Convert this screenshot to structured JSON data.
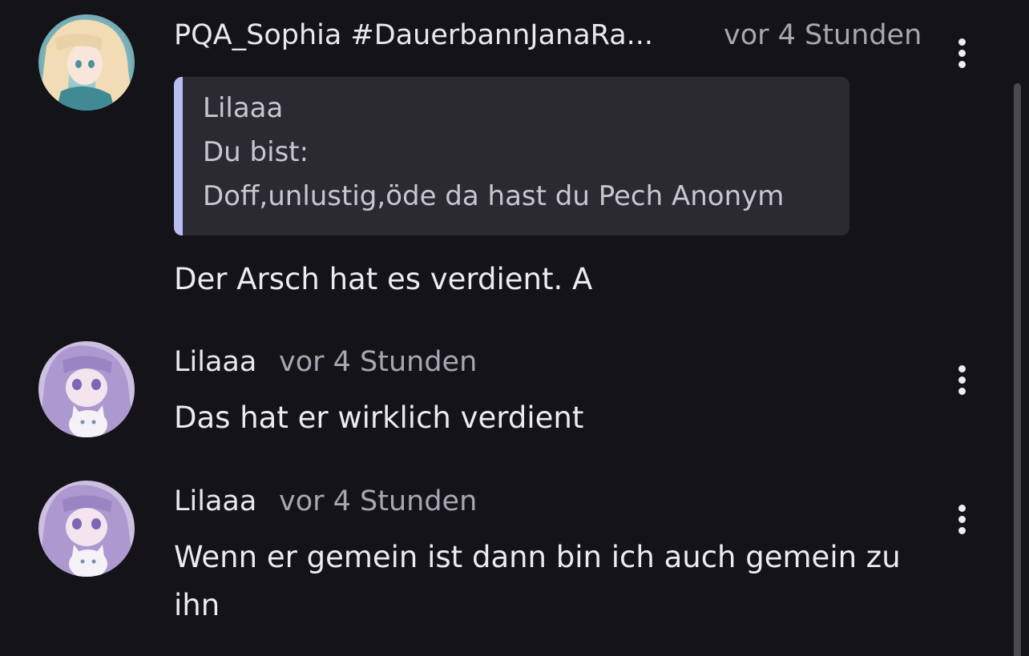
{
  "comments": [
    {
      "username": "PQA_Sophia #DauerbannJanaRa...",
      "time": "vor 4 Stunden",
      "avatar_icon": "anime-girl-blonde-avatar",
      "quote": {
        "author": "Lilaaa",
        "lines": [
          "Du bist:",
          "Doff,unlustig,öde da hast du Pech Anonym"
        ]
      },
      "text": "Der Arsch hat es verdient. A"
    },
    {
      "username": "Lilaaa",
      "time": "vor 4 Stunden",
      "avatar_icon": "anime-girl-lilac-cat-avatar",
      "text": "Das hat er wirklich verdient"
    },
    {
      "username": "Lilaaa",
      "time": "vor 4 Stunden",
      "avatar_icon": "anime-girl-lilac-cat-avatar",
      "text_lines": [
        "Wenn er gemein ist dann bin ich auch gemein zu",
        "ihn"
      ]
    }
  ],
  "colors": {
    "background": "#141318",
    "quote_background": "#2b2a31",
    "quote_accent": "#b9bdf2",
    "primary_text": "#ecebf1",
    "secondary_text": "#a8a6b0"
  }
}
